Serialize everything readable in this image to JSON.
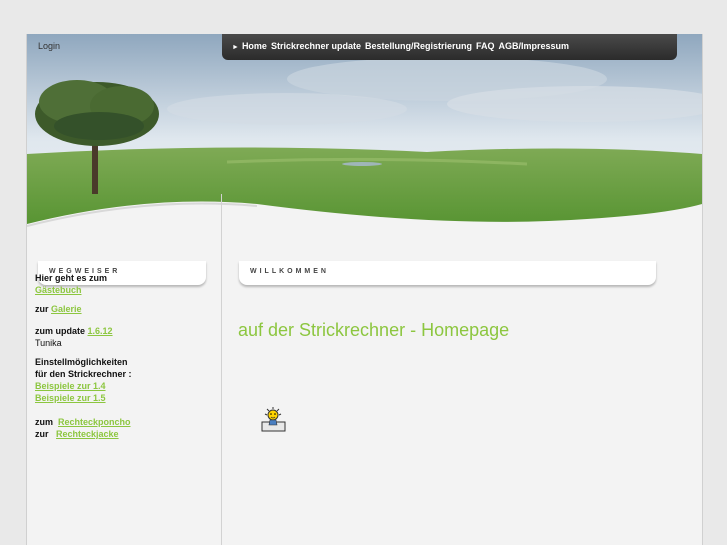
{
  "login": "Login",
  "nav": [
    {
      "label": "Home"
    },
    {
      "label": "Strickrechner update"
    },
    {
      "label": "Bestellung/Registrierung"
    },
    {
      "label": "FAQ"
    },
    {
      "label": "AGB/Impressum"
    }
  ],
  "left_panel": {
    "title": "WEGWEISER",
    "lines": {
      "l1": "Hier geht es zum",
      "l1_link": "Gästebuch",
      "l2_prefix": "zur",
      "l2_link": "Galerie",
      "l3_prefix": "zum update",
      "l3_link": "1.6.12",
      "l3_suffix": "Tunika",
      "l4a": "Einstellmöglichkeiten",
      "l4b": "für den Strickrechner :",
      "l4_link1": "Beispiele zur 1.4",
      "l4_link2": "Beispiele zur 1.5",
      "l5_prefix": "zum",
      "l5_link": "Rechteckponcho",
      "l6_prefix": "zur",
      "l6_link": "Rechteckjacke"
    }
  },
  "main": {
    "title": "WILLKOMMEN",
    "heading": "auf der Strickrechner - Homepage",
    "icon": "cartoon-figure-icon"
  },
  "colors": {
    "accent": "#8cc63f",
    "nav_bg": "#333333"
  }
}
